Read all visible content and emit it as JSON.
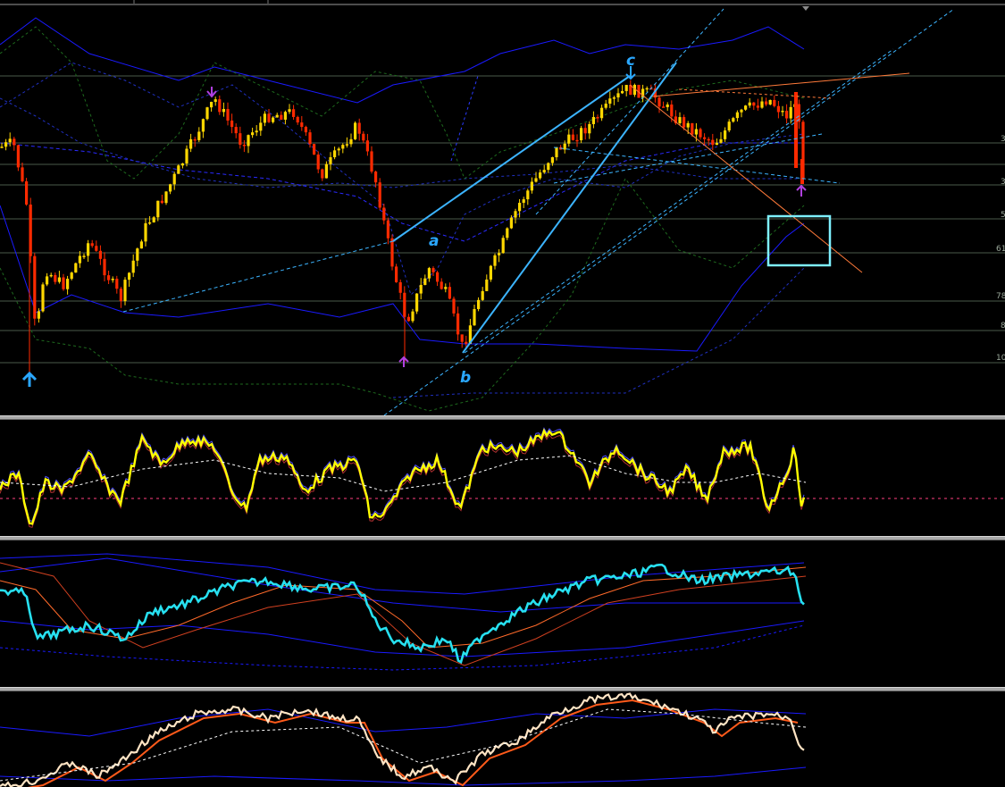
{
  "window": {
    "title": ""
  },
  "main_chart": {
    "wave_labels": [
      {
        "id": "a",
        "text": "a"
      },
      {
        "id": "b",
        "text": "b"
      },
      {
        "id": "c",
        "text": "c"
      }
    ],
    "fib_labels": [
      "3",
      "3",
      "5",
      "61",
      "78",
      "8",
      "10"
    ],
    "colors": {
      "background": "#000000",
      "bull_candle": "#ffd700",
      "bear_candle": "#ff2a00",
      "bollinger": "#1a1aff",
      "wave_lines": "#3cb4ff",
      "orange_channel": "#ff7a3a",
      "fib_levels": "#5b6b5b",
      "target_box": "#7ef0ff",
      "arrow_up": "#2aa7ff",
      "arrow_fractal": "#b040e0"
    },
    "icons": [
      "arrow-up-icon",
      "fractal-down-arrow-icon",
      "fractal-up-arrow-icon",
      "wave-c-arrow-icon"
    ]
  },
  "rsi_panel": {
    "colors": {
      "main_line": "#ffff00",
      "signal": "#ffffff",
      "level": "#ff4080"
    }
  },
  "momentum_panel": {
    "colors": {
      "main_line": "#27e0f0",
      "bands": "#1a1aff",
      "ma": "#ff6a2a"
    }
  },
  "macd_panel": {
    "colors": {
      "pos_hist": "#2a9cd0",
      "neg_hist": "#c01870",
      "line1": "#ffe4c4",
      "line2": "#ff5a1a",
      "signal": "#ffffff"
    }
  }
}
